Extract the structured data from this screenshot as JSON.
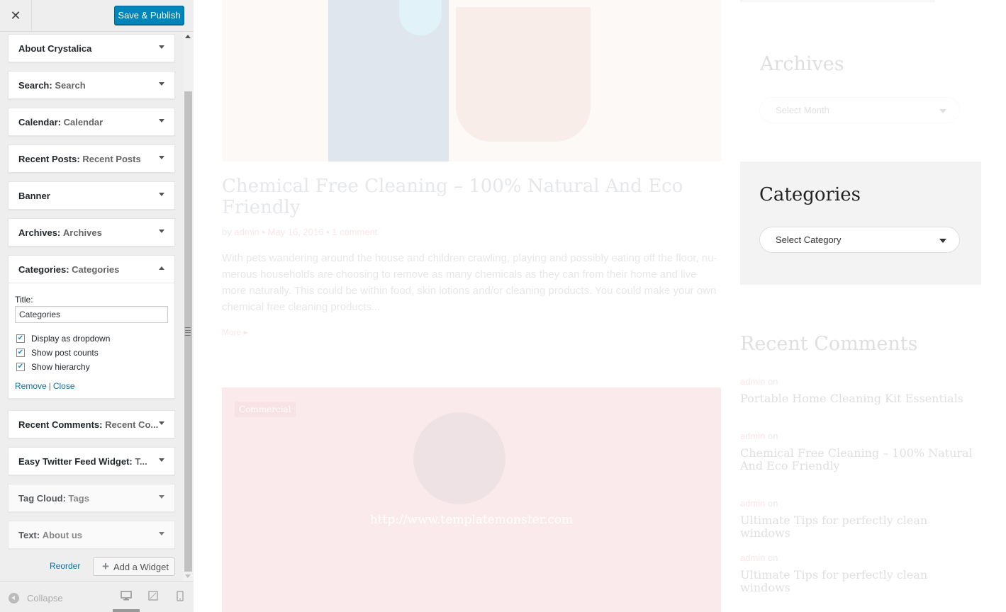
{
  "panel": {
    "close_glyph": "✕",
    "save_label": "Save & Publish",
    "widgets": [
      {
        "name": "About Crystalica",
        "title": ""
      },
      {
        "name": "Search",
        "title": "Search"
      },
      {
        "name": "Calendar",
        "title": "Calendar"
      },
      {
        "name": "Recent Posts",
        "title": "Recent Posts"
      },
      {
        "name": "Banner",
        "title": ""
      },
      {
        "name": "Archives",
        "title": "Archives"
      },
      {
        "name": "Categories",
        "title": "Categories"
      },
      {
        "name": "Recent Comments",
        "title": "Recent Co..."
      },
      {
        "name": "Easy Twitter Feed Widget",
        "title": "T..."
      },
      {
        "name": "Tag Cloud",
        "title": "Tags"
      },
      {
        "name": "Text",
        "title": "About us"
      }
    ],
    "categories_form": {
      "title_label": "Title:",
      "title_value": "Categories",
      "options": [
        {
          "label": "Display as dropdown",
          "checked": true
        },
        {
          "label": "Show post counts",
          "checked": true
        },
        {
          "label": "Show hierarchy",
          "checked": true
        }
      ],
      "remove_label": "Remove",
      "close_label": "Close"
    },
    "reorder_label": "Reorder",
    "add_widget_label": "Add a Widget",
    "collapse_label": "Collapse"
  },
  "preview": {
    "post": {
      "title": "Chemical Free Cleaning – 100% Natural And Eco Friendly",
      "meta_by": "by",
      "meta_author": "admin",
      "meta_date": "May 16, 2016",
      "meta_comments": "1 comment",
      "excerpt": "With pets wandering around the house and children crawling, playing and possibly eating off the floor, nu-merous households are choosing to remove as many chemicals as they can from their home and live more naturally. This could be within food, skin lotions and/or cleaning products. You could make your own chemical free cleaning products...",
      "more_label": "More"
    },
    "image2": {
      "tag": "Commercial",
      "watermark": "http://www.templatemonster.com"
    },
    "sidebar": {
      "archives_title": "Archives",
      "archives_select": "Select Month",
      "categories_title": "Categories",
      "categories_select": "Select Category",
      "recent_comments_title": "Recent Comments",
      "comments": [
        {
          "author": "admin",
          "on": "on",
          "post": "Portable Home Cleaning Kit Essentials"
        },
        {
          "author": "admin",
          "on": "on",
          "post": "Chemical Free Cleaning – 100% Natural And Eco Friendly"
        },
        {
          "author": "admin",
          "on": "on",
          "post": "Ultimate Tips for perfectly clean windows"
        },
        {
          "author": "admin",
          "on": "on",
          "post": "Ultimate Tips for perfectly clean windows"
        }
      ]
    }
  },
  "colors": {
    "primary_button": "#0085ba",
    "link": "#0073aa",
    "accent": "#e05a6a"
  }
}
